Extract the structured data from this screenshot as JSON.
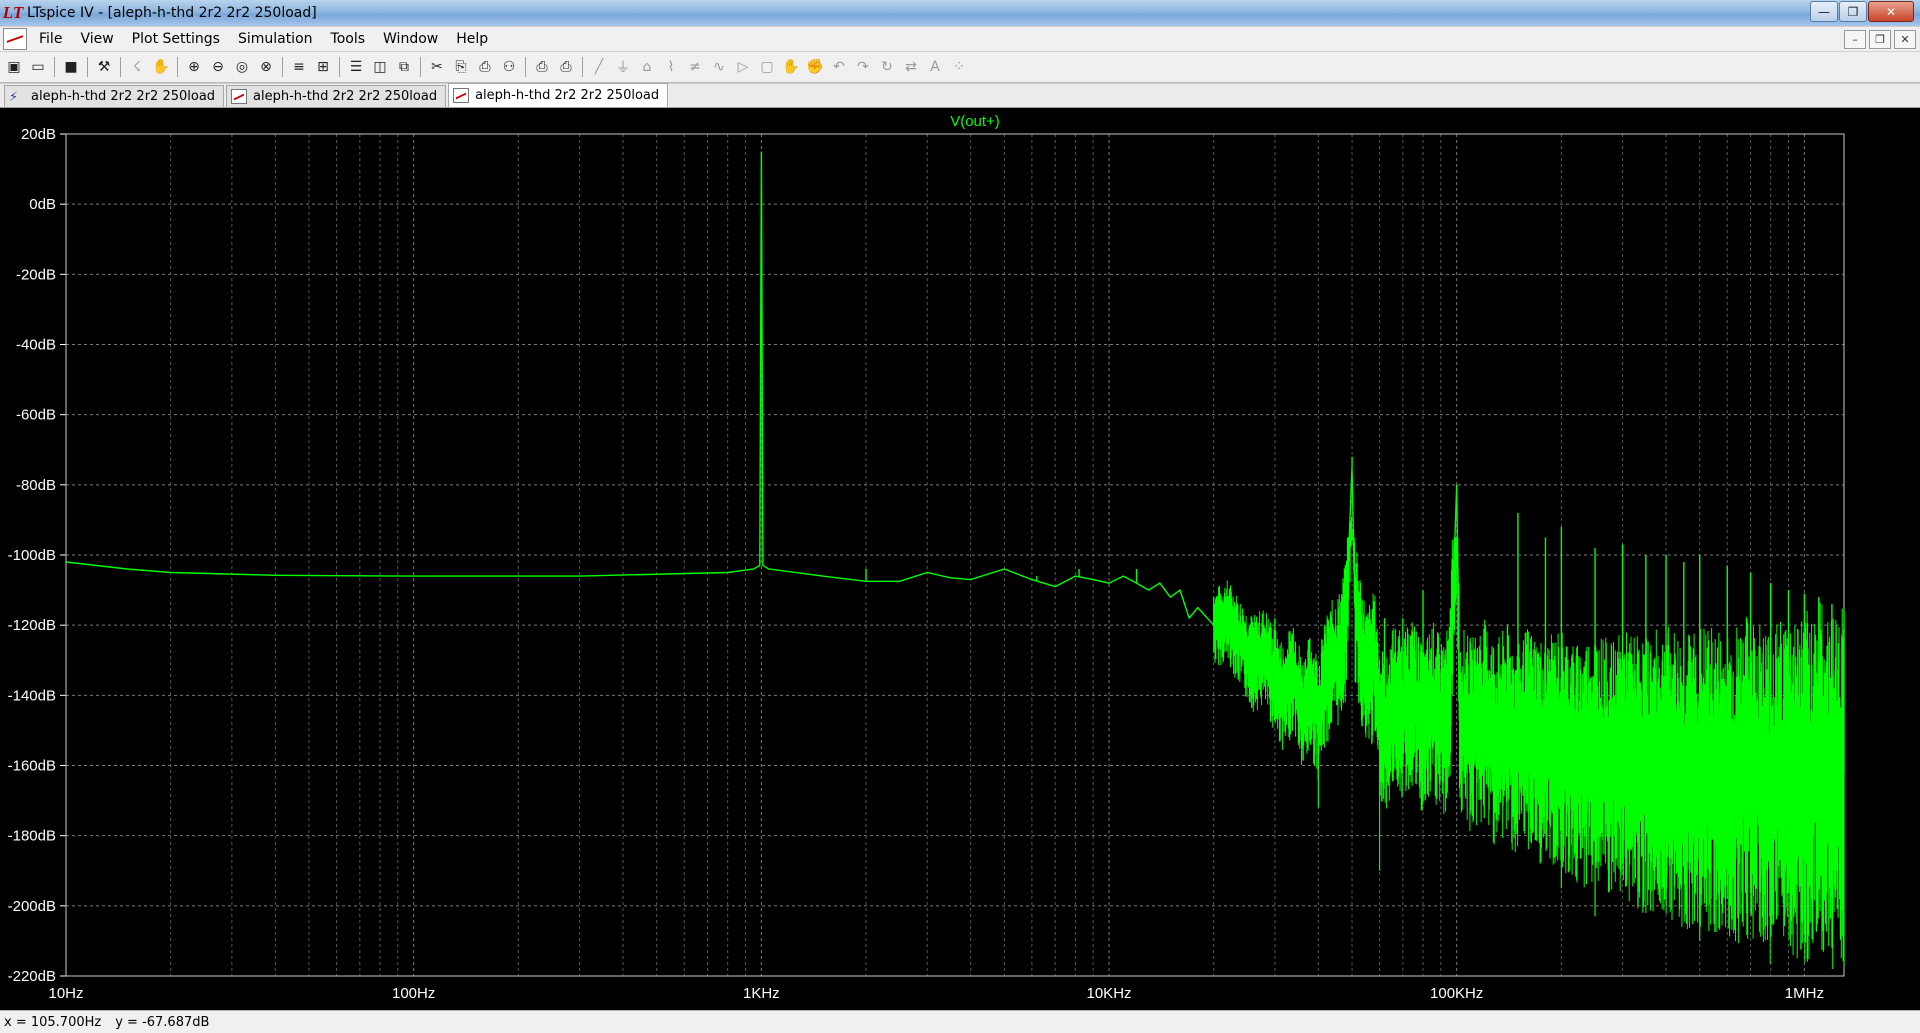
{
  "window": {
    "title": "LTspice IV - [aleph-h-thd 2r2 2r2 250load]",
    "app_icon_glyph": "LT"
  },
  "menu": [
    "File",
    "View",
    "Plot Settings",
    "Simulation",
    "Tools",
    "Window",
    "Help"
  ],
  "toolbar_icons": [
    "new-schematic-icon",
    "open-icon",
    "save-icon",
    "control-panel-icon",
    "run-icon",
    "halt-icon",
    "zoom-in-icon",
    "zoom-out-icon",
    "zoom-fit-icon",
    "zoom-cancel-icon",
    "autorange-icon",
    "grid-icon",
    "tile-horizontal-icon",
    "tile-vertical-icon",
    "cascade-icon",
    "cut-icon",
    "copy-icon",
    "paste-icon",
    "find-icon",
    "print-preview-icon",
    "print-icon",
    "wire-icon",
    "ground-icon",
    "label-icon",
    "resistor-icon",
    "capacitor-icon",
    "inductor-icon",
    "diode-icon",
    "component-icon",
    "move-icon",
    "drag-icon",
    "undo-icon",
    "redo-icon",
    "rotate-icon",
    "mirror-icon",
    "text-icon",
    "spice-directive-icon"
  ],
  "tabs": [
    {
      "label": "aleph-h-thd 2r2 2r2 250load",
      "kind": "schematic",
      "active": false
    },
    {
      "label": "aleph-h-thd 2r2 2r2 250load",
      "kind": "plot",
      "active": false
    },
    {
      "label": "aleph-h-thd 2r2 2r2 250load",
      "kind": "plot",
      "active": true
    }
  ],
  "status": {
    "x": "x = 105.700Hz",
    "y": "y = -67.687dB"
  },
  "colors": {
    "trace": "#00ff00",
    "background": "#000000",
    "grid": "#7a7a7a",
    "axis_text": "#ffffff"
  },
  "chart_data": {
    "type": "line",
    "title": "V(out+)",
    "xscale": "log",
    "xlim": [
      10,
      1300000
    ],
    "ylim": [
      -220,
      20
    ],
    "x_ticks": [
      {
        "value": 10,
        "label": "10Hz"
      },
      {
        "value": 100,
        "label": "100Hz"
      },
      {
        "value": 1000,
        "label": "1KHz"
      },
      {
        "value": 10000,
        "label": "10KHz"
      },
      {
        "value": 100000,
        "label": "100KHz"
      },
      {
        "value": 1000000,
        "label": "1MHz"
      }
    ],
    "y_ticks": [
      {
        "value": 20,
        "label": "20dB"
      },
      {
        "value": 0,
        "label": "0dB"
      },
      {
        "value": -20,
        "label": "-20dB"
      },
      {
        "value": -40,
        "label": "-40dB"
      },
      {
        "value": -60,
        "label": "-60dB"
      },
      {
        "value": -80,
        "label": "-80dB"
      },
      {
        "value": -100,
        "label": "-100dB"
      },
      {
        "value": -120,
        "label": "-120dB"
      },
      {
        "value": -140,
        "label": "-140dB"
      },
      {
        "value": -160,
        "label": "-160dB"
      },
      {
        "value": -180,
        "label": "-180dB"
      },
      {
        "value": -200,
        "label": "-200dB"
      },
      {
        "value": -220,
        "label": "-220dB"
      }
    ],
    "grid": true,
    "series": [
      {
        "name": "V(out+)",
        "points": [
          [
            10,
            -102
          ],
          [
            15,
            -104
          ],
          [
            20,
            -105
          ],
          [
            40,
            -105.8
          ],
          [
            100,
            -106
          ],
          [
            300,
            -106
          ],
          [
            800,
            -105
          ],
          [
            950,
            -104
          ],
          [
            990,
            -103
          ],
          [
            1000,
            15
          ],
          [
            1010,
            -103
          ],
          [
            1050,
            -104
          ],
          [
            1500,
            -106
          ],
          [
            2000,
            -107.5
          ],
          [
            2500,
            -107.5
          ],
          [
            3000,
            -105
          ],
          [
            3500,
            -106.5
          ],
          [
            4000,
            -107
          ],
          [
            5000,
            -104
          ],
          [
            6000,
            -107
          ],
          [
            7000,
            -109
          ],
          [
            8000,
            -106
          ],
          [
            9000,
            -107
          ],
          [
            10000,
            -108
          ],
          [
            11000,
            -106
          ],
          [
            12000,
            -108
          ],
          [
            13000,
            -110
          ],
          [
            14000,
            -108
          ],
          [
            15000,
            -112
          ],
          [
            16000,
            -110
          ],
          [
            17000,
            -118
          ],
          [
            18000,
            -115
          ],
          [
            20000,
            -120
          ],
          [
            22000,
            -118
          ],
          [
            24000,
            -125
          ],
          [
            26000,
            -130
          ],
          [
            28000,
            -128
          ],
          [
            30000,
            -135
          ],
          [
            32000,
            -140
          ],
          [
            34000,
            -132
          ],
          [
            36000,
            -145
          ],
          [
            38000,
            -138
          ],
          [
            40000,
            -145
          ],
          [
            42000,
            -135
          ],
          [
            44000,
            -130
          ],
          [
            46000,
            -128
          ],
          [
            48000,
            -120
          ],
          [
            50000,
            -75
          ],
          [
            51000,
            -115
          ],
          [
            53000,
            -125
          ],
          [
            55000,
            -135
          ],
          [
            58000,
            -130
          ],
          [
            60000,
            -145
          ],
          [
            63000,
            -150
          ],
          [
            66000,
            -140
          ],
          [
            70000,
            -145
          ],
          [
            75000,
            -140
          ],
          [
            80000,
            -150
          ],
          [
            85000,
            -142
          ],
          [
            90000,
            -148
          ],
          [
            95000,
            -145
          ],
          [
            100000,
            -80
          ],
          [
            102000,
            -145
          ],
          [
            110000,
            -150
          ],
          [
            120000,
            -145
          ],
          [
            130000,
            -152
          ],
          [
            140000,
            -148
          ],
          [
            150000,
            -155
          ],
          [
            160000,
            -150
          ],
          [
            180000,
            -155
          ],
          [
            200000,
            -152
          ],
          [
            220000,
            -158
          ],
          [
            250000,
            -155
          ],
          [
            280000,
            -160
          ],
          [
            300000,
            -157
          ],
          [
            350000,
            -160
          ],
          [
            400000,
            -158
          ],
          [
            450000,
            -162
          ],
          [
            500000,
            -160
          ],
          [
            600000,
            -163
          ],
          [
            700000,
            -160
          ],
          [
            800000,
            -165
          ],
          [
            900000,
            -162
          ],
          [
            1000000,
            -163
          ],
          [
            1100000,
            -160
          ],
          [
            1200000,
            -165
          ],
          [
            1300000,
            -162
          ]
        ],
        "spikes": [
          [
            2000,
            -104
          ],
          [
            5000,
            -104
          ],
          [
            6200,
            -106
          ],
          [
            8200,
            -104
          ],
          [
            12000,
            -104
          ],
          [
            20000,
            -112
          ],
          [
            30000,
            -118
          ],
          [
            44000,
            -120
          ],
          [
            50000,
            -72
          ],
          [
            62000,
            -118
          ],
          [
            70000,
            -118
          ],
          [
            80000,
            -110
          ],
          [
            100000,
            -80
          ],
          [
            150000,
            -88
          ],
          [
            180000,
            -95
          ],
          [
            200000,
            -92
          ],
          [
            250000,
            -98
          ],
          [
            300000,
            -97
          ],
          [
            350000,
            -100
          ],
          [
            400000,
            -100
          ],
          [
            450000,
            -102
          ],
          [
            500000,
            -100
          ],
          [
            600000,
            -103
          ],
          [
            700000,
            -105
          ],
          [
            800000,
            -108
          ],
          [
            900000,
            -110
          ],
          [
            1000000,
            -111
          ],
          [
            1100000,
            -112
          ],
          [
            1200000,
            -114
          ],
          [
            1300000,
            -116
          ]
        ],
        "dips": [
          [
            40000,
            -172
          ],
          [
            60000,
            -190
          ],
          [
            120000,
            -175
          ],
          [
            200000,
            -195
          ],
          [
            250000,
            -203
          ],
          [
            300000,
            -188
          ],
          [
            400000,
            -200
          ],
          [
            500000,
            -210
          ],
          [
            600000,
            -198
          ],
          [
            800000,
            -205
          ],
          [
            1000000,
            -208
          ],
          [
            1200000,
            -212
          ],
          [
            1300000,
            -217
          ]
        ]
      }
    ]
  }
}
